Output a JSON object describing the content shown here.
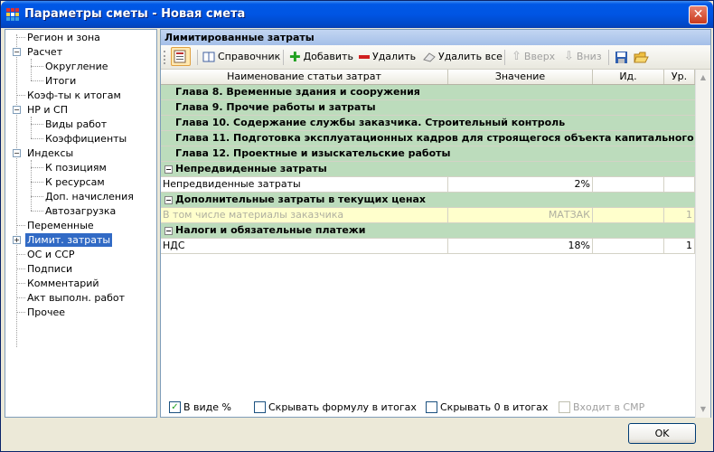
{
  "window": {
    "title": "Параметры сметы - Новая смета",
    "close_label": "✕"
  },
  "nav": {
    "items": [
      {
        "label": "Регион и зона"
      },
      {
        "label": "Расчет"
      },
      {
        "label": "Округление"
      },
      {
        "label": "Итоги"
      },
      {
        "label": "Коэф-ты к итогам"
      },
      {
        "label": "НР и СП"
      },
      {
        "label": "Виды работ"
      },
      {
        "label": "Коэффициенты"
      },
      {
        "label": "Индексы"
      },
      {
        "label": "К позициям"
      },
      {
        "label": "К ресурсам"
      },
      {
        "label": "Доп. начисления"
      },
      {
        "label": "Автозагрузка"
      },
      {
        "label": "Переменные"
      },
      {
        "label": "Лимит. затраты"
      },
      {
        "label": "ОС и ССР"
      },
      {
        "label": "Подписи"
      },
      {
        "label": "Комментарий"
      },
      {
        "label": "Акт выполн. работ"
      },
      {
        "label": "Прочее"
      }
    ],
    "selected": "Лимит. затраты"
  },
  "panel": {
    "title": "Лимитированные затраты"
  },
  "toolbar": {
    "reference": "Справочник",
    "add": "Добавить",
    "delete": "Удалить",
    "delete_all": "Удалить все",
    "up": "Вверх",
    "down": "Вниз"
  },
  "table": {
    "headers": [
      "Наименование статьи затрат",
      "Значение",
      "Ид.",
      "Ур."
    ],
    "rows": [
      {
        "type": "chapter",
        "name": "Глава 8. Временные здания и сооружения"
      },
      {
        "type": "chapter",
        "name": "Глава 9. Прочие работы и затраты"
      },
      {
        "type": "chapter",
        "name": "Глава 10. Содержание службы заказчика. Строительный контроль"
      },
      {
        "type": "chapter",
        "name": "Глава 11. Подготовка эксплуатационных кадров для строящегося объекта капитального"
      },
      {
        "type": "chapter",
        "name": "Глава 12. Проектные и изыскательские работы"
      },
      {
        "type": "group",
        "name": "Непредвиденные затраты"
      },
      {
        "type": "item",
        "name": "Непредвиденные затраты",
        "value": "2%",
        "id": "",
        "level": ""
      },
      {
        "type": "group",
        "name": "Дополнительные затраты в текущих ценах"
      },
      {
        "type": "yellow",
        "name": "В том числе материалы заказчика",
        "value": "МАТЗАК",
        "id": "",
        "level": "1"
      },
      {
        "type": "group",
        "name": "Налоги и обязательные платежи"
      },
      {
        "type": "item",
        "name": "НДС",
        "value": "18%",
        "id": "",
        "level": "1"
      }
    ]
  },
  "options": {
    "percent": {
      "label": "В виде %",
      "checked": true
    },
    "hide_formula": {
      "label": "Скрывать формулу в итогах",
      "checked": false
    },
    "hide_zero": {
      "label": "Скрывать 0 в итогах",
      "checked": false
    },
    "in_smr": {
      "label": "Входит в СМР",
      "checked": false
    }
  },
  "ok_label": "OK",
  "colors": {
    "accent": "#316ac5",
    "group_bg": "#bcdcbc",
    "titlebar": "#0055e3"
  }
}
